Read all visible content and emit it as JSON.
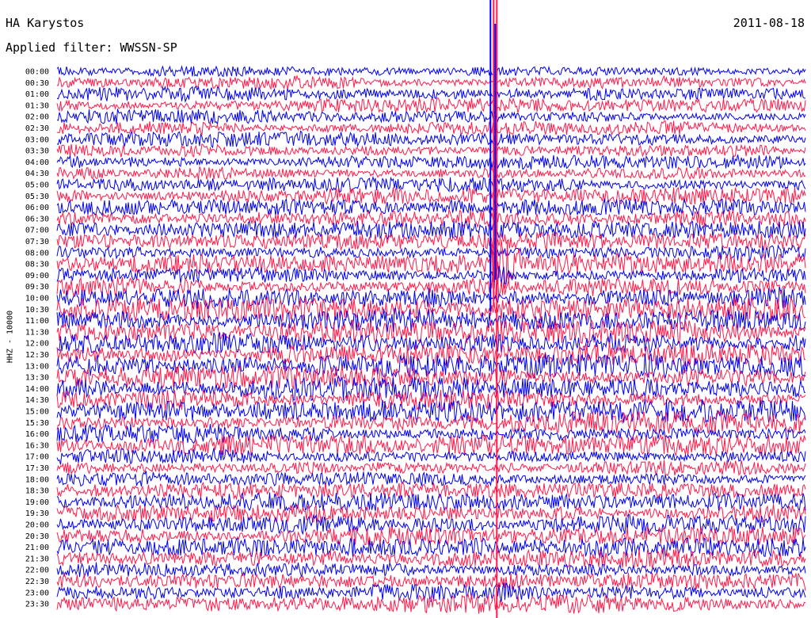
{
  "header": {
    "station": "HA Karystos",
    "date": "2011-08-18",
    "filter": "Applied filter: WWSSN-SP",
    "channel_label": "HHZ - 10000"
  },
  "colors": {
    "trace_a": "#0000ee",
    "trace_b": "#ff1a4a",
    "text": "#000000",
    "background": "#ffffff"
  },
  "chart_data": {
    "type": "line",
    "title": "HA Karystos",
    "subtitle": "Applied filter: WWSSN-SP",
    "date": "2011-08-18",
    "ylabel": "HHZ - 10000",
    "xlabel": "",
    "row_duration_minutes": 30,
    "color_cycle": [
      "#0000ee",
      "#ff1a4a"
    ],
    "rows": [
      "00:00",
      "00:30",
      "01:00",
      "01:30",
      "02:00",
      "02:30",
      "03:00",
      "03:30",
      "04:00",
      "04:30",
      "05:00",
      "05:30",
      "06:00",
      "06:30",
      "07:00",
      "07:30",
      "08:00",
      "08:30",
      "09:00",
      "09:30",
      "10:00",
      "10:30",
      "11:00",
      "11:30",
      "12:00",
      "12:30",
      "13:00",
      "13:30",
      "14:00",
      "14:30",
      "15:00",
      "15:30",
      "16:00",
      "16:30",
      "17:00",
      "17:30",
      "18:00",
      "18:30",
      "19:00",
      "19:30",
      "20:00",
      "20:30",
      "21:00",
      "21:30",
      "22:00",
      "22:30",
      "23:00",
      "23:30"
    ],
    "row_noise_level": [
      0.55,
      0.6,
      0.6,
      0.6,
      0.62,
      0.62,
      0.65,
      0.65,
      0.65,
      0.65,
      0.68,
      0.7,
      0.72,
      0.72,
      0.75,
      0.78,
      0.8,
      0.82,
      0.85,
      0.9,
      0.9,
      0.95,
      1.0,
      1.0,
      1.0,
      1.0,
      1.0,
      0.98,
      0.98,
      0.95,
      0.95,
      0.92,
      0.9,
      0.9,
      0.85,
      0.8,
      0.75,
      0.75,
      0.75,
      0.75,
      0.78,
      0.8,
      0.8,
      0.8,
      0.8,
      0.8,
      0.8,
      0.8
    ],
    "event": {
      "row": "08:30",
      "minute": 17.5,
      "peak_amplitude": "off-scale",
      "coda_rows": [
        "08:30",
        "09:00",
        "09:30"
      ]
    }
  }
}
